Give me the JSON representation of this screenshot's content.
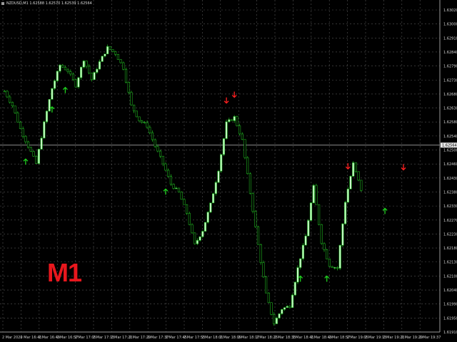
{
  "window": {
    "header": "NZDUSD,M1  1.62588 1.62570 1.62539 1.62564",
    "timeframe_label": "M1"
  },
  "colors": {
    "background": "#000000",
    "grid": "#555555",
    "candle": "#1fae1f",
    "candle_bright": "#c8ffc8",
    "buy_arrow": "#1fd11f",
    "sell_arrow": "#ff2020",
    "timeframe_label": "#e8171d",
    "current_price_line": "#8a8a8a"
  },
  "current_price": {
    "label": "1.62564",
    "value": 1.62564
  },
  "chart_data": {
    "type": "candlestick",
    "title": "",
    "y_ticks": [
      "1.63020",
      "1.63000",
      "1.62910",
      "1.62840",
      "1.62790",
      "1.62730",
      "1.62680",
      "1.62630",
      "1.62580",
      "1.62540",
      "1.62500",
      "1.62460",
      "1.62430",
      "1.62380",
      "1.62330",
      "1.62270",
      "1.62230",
      "1.62180",
      "1.62130",
      "1.62100",
      "1.62040",
      "1.61990",
      "1.61950",
      "1.61910"
    ],
    "x_ticks": [
      "2 Mar 2020",
      "2 Mar 16:41",
      "2 Mar 16:49",
      "2 Mar 16:57",
      "2 Mar 17:05",
      "2 Mar 17:13",
      "2 Mar 17:21",
      "2 Mar 17:29",
      "2 Mar 17:37",
      "2 Mar 17:45",
      "2 Mar 17:53",
      "2 Mar 18:01",
      "2 Mar 18:09",
      "2 Mar 18:17",
      "2 Mar 18:25",
      "2 Mar 18:33",
      "2 Mar 18:41",
      "2 Mar 18:49",
      "2 Mar 18:57",
      "2 Mar 19:05",
      "2 Mar 19:13",
      "2 Mar 19:21",
      "2 Mar 19:29",
      "2 Mar 19:37"
    ],
    "close_path": [
      [
        0,
        1.6275
      ],
      [
        3,
        1.627
      ],
      [
        6,
        1.6262
      ],
      [
        9,
        1.6256
      ],
      [
        12,
        1.625
      ],
      [
        15,
        1.6264
      ],
      [
        18,
        1.6276
      ],
      [
        21,
        1.6284
      ],
      [
        24,
        1.6282
      ],
      [
        27,
        1.6277
      ],
      [
        30,
        1.6286
      ],
      [
        33,
        1.6279
      ],
      [
        36,
        1.6285
      ],
      [
        39,
        1.629
      ],
      [
        42,
        1.6288
      ],
      [
        45,
        1.6283
      ],
      [
        48,
        1.627
      ],
      [
        51,
        1.6265
      ],
      [
        54,
        1.6263
      ],
      [
        57,
        1.6256
      ],
      [
        60,
        1.625
      ],
      [
        63,
        1.6243
      ],
      [
        66,
        1.624
      ],
      [
        69,
        1.6233
      ],
      [
        72,
        1.6222
      ],
      [
        75,
        1.6227
      ],
      [
        78,
        1.6236
      ],
      [
        81,
        1.6248
      ],
      [
        84,
        1.6264
      ],
      [
        87,
        1.6266
      ],
      [
        90,
        1.6258
      ],
      [
        93,
        1.624
      ],
      [
        96,
        1.6222
      ],
      [
        99,
        1.6205
      ],
      [
        102,
        1.6195
      ],
      [
        105,
        1.62
      ],
      [
        108,
        1.6201
      ],
      [
        111,
        1.6214
      ],
      [
        114,
        1.6225
      ],
      [
        117,
        1.6242
      ],
      [
        120,
        1.6223
      ],
      [
        123,
        1.6215
      ],
      [
        126,
        1.6214
      ],
      [
        129,
        1.6237
      ],
      [
        132,
        1.625
      ],
      [
        135,
        1.6241
      ]
    ],
    "buy_arrow_times": [
      8,
      18,
      23,
      61,
      112,
      122,
      144
    ],
    "sell_arrow_times": [
      84,
      87,
      130,
      151
    ]
  }
}
